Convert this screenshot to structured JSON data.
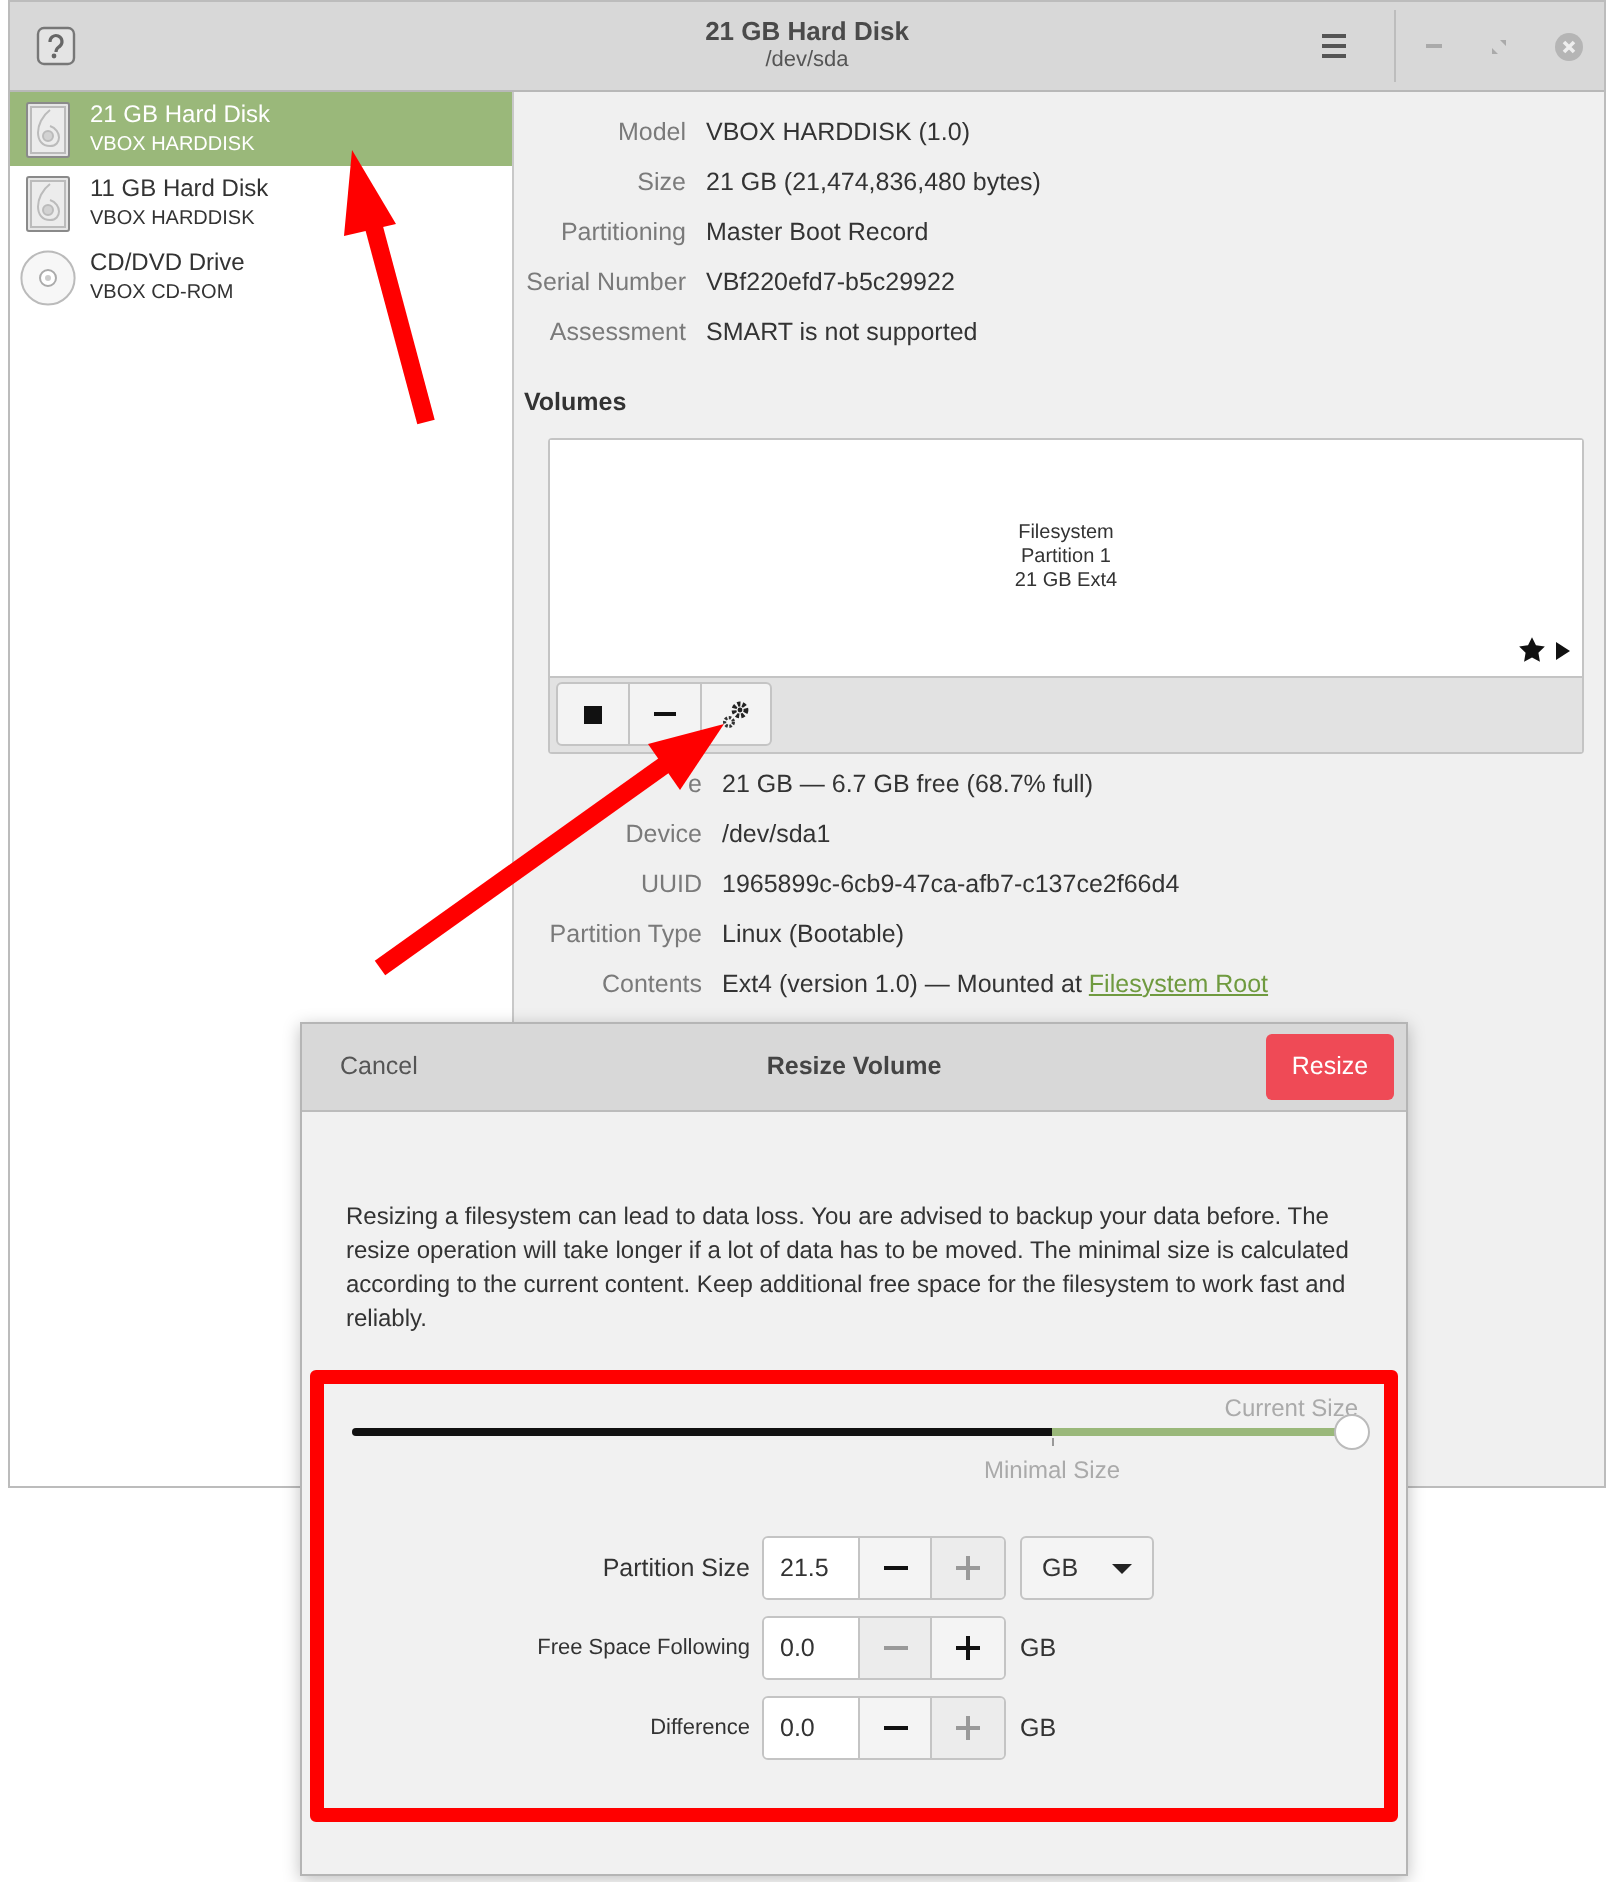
{
  "window": {
    "title": "21 GB Hard Disk",
    "subtitle": "/dev/sda"
  },
  "drives": [
    {
      "kind": "disk",
      "name": "21 GB Hard Disk",
      "model": "VBOX HARDDISK",
      "selected": true
    },
    {
      "kind": "disk",
      "name": "11 GB Hard Disk",
      "model": "VBOX HARDDISK",
      "selected": false
    },
    {
      "kind": "optical",
      "name": "CD/DVD Drive",
      "model": "VBOX CD-ROM",
      "selected": false
    }
  ],
  "drive_info": [
    {
      "label": "Model",
      "value": "VBOX HARDDISK (1.0)"
    },
    {
      "label": "Size",
      "value": "21 GB (21,474,836,480 bytes)"
    },
    {
      "label": "Partitioning",
      "value": "Master Boot Record"
    },
    {
      "label": "Serial Number",
      "value": "VBf220efd7-b5c29922"
    },
    {
      "label": "Assessment",
      "value": "SMART is not supported"
    }
  ],
  "volumes": {
    "heading": "Volumes",
    "partition": [
      "Filesystem",
      "Partition 1",
      "21 GB Ext4"
    ],
    "details": [
      {
        "label": "e",
        "value": "21 GB — 6.7 GB free (68.7% full)"
      },
      {
        "label": "Device",
        "value": "/dev/sda1"
      },
      {
        "label": "UUID",
        "value": "1965899c-6cb9-47ca-afb7-c137ce2f66d4"
      },
      {
        "label": "Partition Type",
        "value": "Linux (Bootable)"
      },
      {
        "label": "Contents",
        "value": "Ext4 (version 1.0) — Mounted at ",
        "link": "Filesystem Root"
      }
    ]
  },
  "dialog": {
    "cancel": "Cancel",
    "title": "Resize Volume",
    "confirm": "Resize",
    "message": "Resizing a filesystem can lead to data loss. You are advised to backup your data before. The resize operation will take longer if a lot of data has to be moved. The minimal size is calculated according to the current content. Keep additional free space for the filesystem to work fast and reliably.",
    "slider": {
      "current_label": "Current Size",
      "level": 1,
      "minimum": {
        "label": "Minimal Size",
        "level": 0.7
      }
    },
    "fields": [
      {
        "label": "Partition Size",
        "value": "21.5",
        "decrease_disabled": false,
        "increase_disabled": true,
        "unit": {
          "kind": "dropdown",
          "text": "GB"
        }
      },
      {
        "label": "Free Space Following",
        "value": "0.0",
        "decrease_disabled": true,
        "increase_disabled": false,
        "unit": {
          "kind": "text",
          "text": "GB"
        }
      },
      {
        "label": "Difference",
        "value": "0.0",
        "decrease_disabled": false,
        "increase_disabled": true,
        "unit": {
          "kind": "text",
          "text": "GB"
        }
      }
    ]
  }
}
